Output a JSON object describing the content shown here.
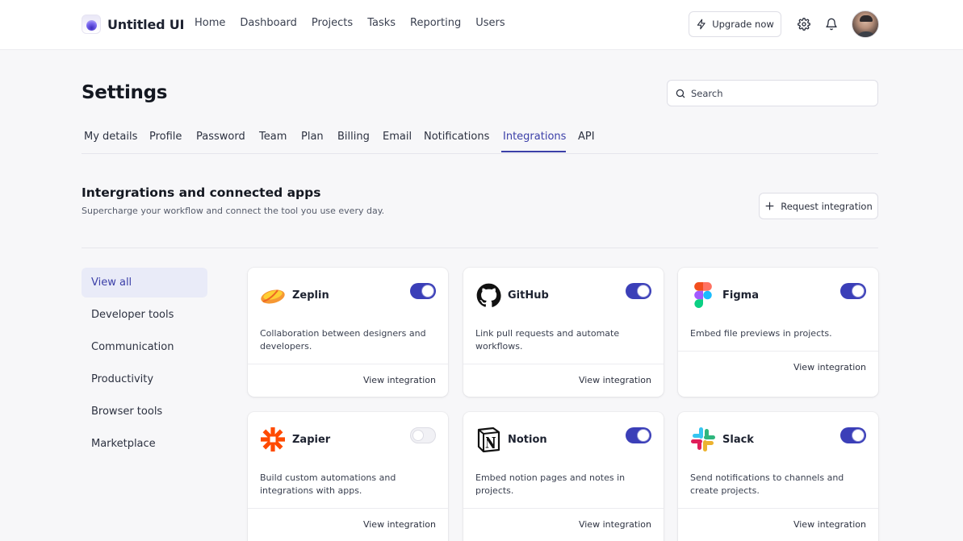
{
  "app": {
    "name": "Untitled UI"
  },
  "nav": {
    "items": [
      "Home",
      "Dashboard",
      "Projects",
      "Tasks",
      "Reporting",
      "Users"
    ],
    "upgrade_label": "Upgrade now"
  },
  "page": {
    "title": "Settings",
    "search_placeholder": "Search"
  },
  "tabs": {
    "items": [
      "My details",
      "Profile",
      "Password",
      "Team",
      "Plan",
      "Billing",
      "Email",
      "Notifications",
      "Integrations",
      "API"
    ],
    "active": "Integrations"
  },
  "section": {
    "title": "Intergrations and connected apps",
    "subtitle": "Supercharge your workflow and connect the tool you use every day.",
    "request_label": "Request integration"
  },
  "sidebar": {
    "items": [
      "View all",
      "Developer tools",
      "Communication",
      "Productivity",
      "Browser tools",
      "Marketplace"
    ],
    "active": "View all"
  },
  "integrations": [
    {
      "name": "Zeplin",
      "description": "Collaboration between designers and developers.",
      "enabled": true,
      "link": "View integration",
      "icon": "zeplin-logo-icon"
    },
    {
      "name": "GitHub",
      "description": "Link pull requests and automate workflows.",
      "enabled": true,
      "link": "View integration",
      "icon": "github-logo-icon"
    },
    {
      "name": "Figma",
      "description": "Embed file previews in projects.",
      "enabled": true,
      "link": "View integration",
      "icon": "figma-logo-icon"
    },
    {
      "name": "Zapier",
      "description": "Build custom automations and integrations with apps.",
      "enabled": false,
      "link": "View integration",
      "icon": "zapier-logo-icon"
    },
    {
      "name": "Notion",
      "description": "Embed notion pages and notes in projects.",
      "enabled": true,
      "link": "View integration",
      "icon": "notion-logo-icon"
    },
    {
      "name": "Slack",
      "description": "Send notifications to channels and create projects.",
      "enabled": true,
      "link": "View integration",
      "icon": "slack-logo-icon"
    }
  ],
  "colors": {
    "accent": "#3b3fb8",
    "active_text": "#3b3fa8",
    "active_bg": "#e9ebf8"
  }
}
